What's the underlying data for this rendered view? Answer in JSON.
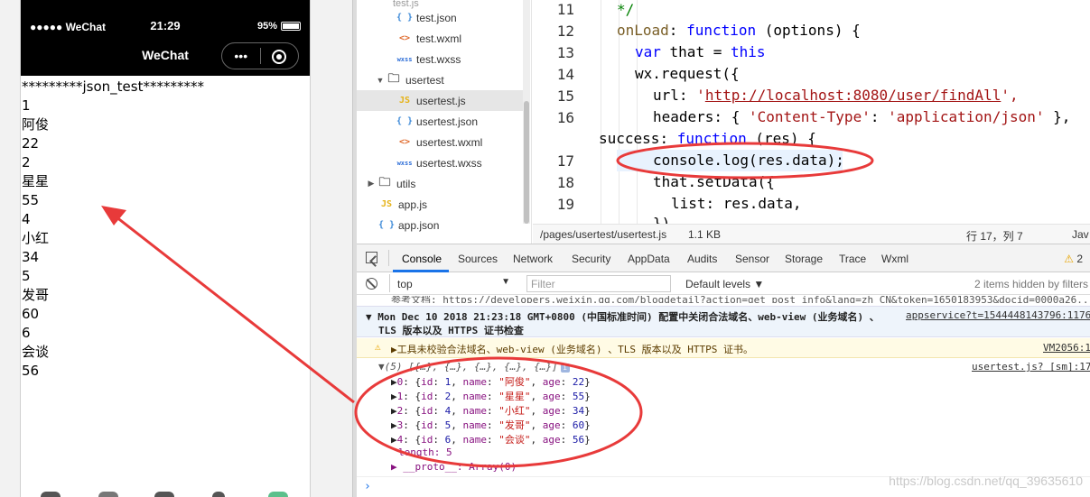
{
  "simulator": {
    "status_signal": "●●●●● WeChat",
    "status_time": "21:29",
    "status_battery": "95%",
    "nav_title": "WeChat",
    "capsule_more": "•••",
    "page_lines": [
      "*********json_test*********",
      "1",
      "阿俊",
      "22",
      "2",
      "星星",
      "55",
      "4",
      "小红",
      "34",
      "5",
      "发哥",
      "60",
      "6",
      "会谈",
      "56"
    ]
  },
  "file_tree": {
    "items": [
      {
        "icon": "{ }",
        "type": "json",
        "label": "test.json"
      },
      {
        "icon": "<>",
        "type": "wxml",
        "label": "test.wxml"
      },
      {
        "icon": "wxss",
        "type": "wxss",
        "label": "test.wxss"
      },
      {
        "icon": "▼",
        "type": "folder",
        "label": "usertest"
      },
      {
        "icon": "JS",
        "type": "js",
        "label": "usertest.js"
      },
      {
        "icon": "{ }",
        "type": "json",
        "label": "usertest.json"
      },
      {
        "icon": "<>",
        "type": "wxml",
        "label": "usertest.wxml"
      },
      {
        "icon": "wxss",
        "type": "wxss",
        "label": "usertest.wxss"
      },
      {
        "icon": "▶",
        "type": "folder",
        "label": "utils"
      },
      {
        "icon": "JS",
        "type": "js",
        "label": "app.js"
      },
      {
        "icon": "{ }",
        "type": "json",
        "label": "app.json"
      }
    ]
  },
  "editor": {
    "line_numbers": [
      "11",
      "12",
      "13",
      "14",
      "15",
      "16",
      "",
      "17",
      "18",
      "19"
    ],
    "code": {
      "l11": "*/",
      "l12_a": "onLoad",
      "l12_b": ": ",
      "l12_c": "function",
      "l12_d": " (options) {",
      "l13_a": "var",
      "l13_b": " that = ",
      "l13_c": "this",
      "l14": "wx.request({",
      "l15_a": "url: ",
      "l15_b": "'",
      "l15_c": "http://localhost:8080/user/findAll",
      "l15_d": "',",
      "l16_a": "headers: { ",
      "l16_b": "'Content-Type'",
      "l16_c": ": ",
      "l16_d": "'application/json'",
      "l16_e": " },",
      "l16b_a": "success",
      "l16b_b": ": ",
      "l16b_c": "function",
      "l16b_d": " (res) {",
      "l17": "console.log(res.data);",
      "l18": "that.setData({",
      "l19": "list: res.data,",
      "l20": "})"
    },
    "status_path": "/pages/usertest/usertest.js",
    "status_size": "1.1 KB",
    "status_pos": "行 17，列 7",
    "status_lang": "Jav"
  },
  "devtools": {
    "tabs": [
      "Console",
      "Sources",
      "Network",
      "Security",
      "AppData",
      "Audits",
      "Sensor",
      "Storage",
      "Trace",
      "Wxml"
    ],
    "warn_count": "2",
    "context": "top",
    "filter_placeholder": "Filter",
    "levels": "Default levels ▼",
    "hidden_text": "2 items hidden by filters",
    "console": {
      "cut_line": "参考文档: https://developers.weixin.qq.com/blogdetail?action=get_post_info&lang=zh_CN&token=1650183953&docid=0000a26...",
      "group_line1": "▼ Mon Dec 10 2018 21:23:18 GMT+0800 (中国标准时间) 配置中关闭合法域名、web-view (业务域名) 、",
      "group_line2": "TLS 版本以及 HTTPS 证书检查",
      "group_link": "appservice?t=1544448143796:1176",
      "warn_text": "工具未校验合法域名、web-view (业务域名) 、TLS 版本以及 HTTPS 证书。",
      "warn_src": "VM2056:1",
      "array_head": "(5) [{…}, {…}, {…}, {…}, {…}]",
      "array_badge": "i",
      "array_src": "usertest.js? [sm]:17",
      "items": [
        {
          "idx": "0",
          "id": "1",
          "name": "\"阿俊\"",
          "age": "22"
        },
        {
          "idx": "1",
          "id": "2",
          "name": "\"星星\"",
          "age": "55"
        },
        {
          "idx": "2",
          "id": "4",
          "name": "\"小红\"",
          "age": "34"
        },
        {
          "idx": "3",
          "id": "5",
          "name": "\"发哥\"",
          "age": "60"
        },
        {
          "idx": "4",
          "id": "6",
          "name": "\"会谈\"",
          "age": "56"
        }
      ],
      "length_line": "length: 5",
      "proto_line": "▶ __proto__: Array(0)",
      "prompt": "›"
    }
  },
  "watermark": "https://blog.csdn.net/qq_39635610",
  "colors": {
    "annotation_red": "#e83a3a",
    "accent_blue": "#1a73e8"
  }
}
